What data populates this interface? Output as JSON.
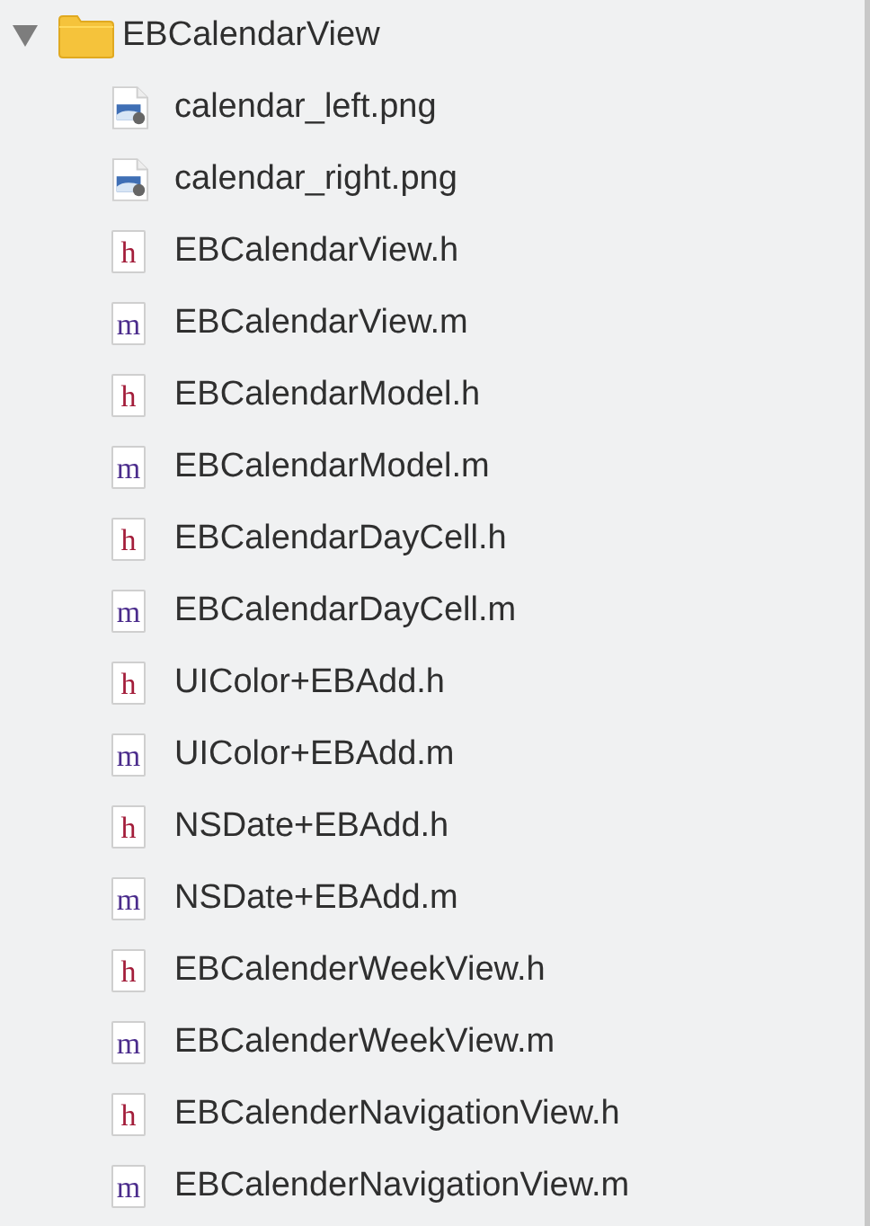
{
  "folder": {
    "name": "EBCalendarView",
    "expanded": true,
    "children": [
      {
        "name": "calendar_left.png",
        "kind": "image"
      },
      {
        "name": "calendar_right.png",
        "kind": "image"
      },
      {
        "name": "EBCalendarView.h",
        "kind": "header",
        "icon_letter": "h"
      },
      {
        "name": "EBCalendarView.m",
        "kind": "implementation",
        "icon_letter": "m"
      },
      {
        "name": "EBCalendarModel.h",
        "kind": "header",
        "icon_letter": "h"
      },
      {
        "name": "EBCalendarModel.m",
        "kind": "implementation",
        "icon_letter": "m"
      },
      {
        "name": "EBCalendarDayCell.h",
        "kind": "header",
        "icon_letter": "h"
      },
      {
        "name": "EBCalendarDayCell.m",
        "kind": "implementation",
        "icon_letter": "m"
      },
      {
        "name": "UIColor+EBAdd.h",
        "kind": "header",
        "icon_letter": "h"
      },
      {
        "name": "UIColor+EBAdd.m",
        "kind": "implementation",
        "icon_letter": "m"
      },
      {
        "name": "NSDate+EBAdd.h",
        "kind": "header",
        "icon_letter": "h"
      },
      {
        "name": "NSDate+EBAdd.m",
        "kind": "implementation",
        "icon_letter": "m"
      },
      {
        "name": "EBCalenderWeekView.h",
        "kind": "header",
        "icon_letter": "h"
      },
      {
        "name": "EBCalenderWeekView.m",
        "kind": "implementation",
        "icon_letter": "m"
      },
      {
        "name": "EBCalenderNavigationView.h",
        "kind": "header",
        "icon_letter": "h"
      },
      {
        "name": "EBCalenderNavigationView.m",
        "kind": "implementation",
        "icon_letter": "m"
      }
    ]
  }
}
